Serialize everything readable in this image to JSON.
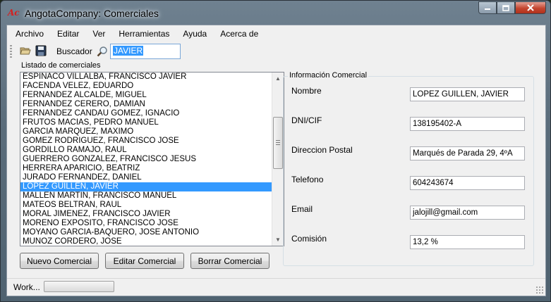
{
  "window": {
    "title": "AngotaCompany: Comerciales",
    "app_icon_text": "Ac"
  },
  "menu": [
    "Archivo",
    "Editar",
    "Ver",
    "Herramientas",
    "Ayuda",
    "Acerca de"
  ],
  "toolbar": {
    "search_label": "Buscador",
    "search_value": "JAVIER"
  },
  "list": {
    "caption": "Listado de comerciales",
    "items": [
      "ESPINACO VILLALBA, FRANCISCO JAVIER",
      "FACENDA VELEZ, EDUARDO",
      "FERNANDEZ ALCALDE, MIGUEL",
      "FERNANDEZ CERERO, DAMIAN",
      "FERNANDEZ CANDAU GOMEZ, IGNACIO",
      "FRUTOS MACIAS, PEDRO MANUEL",
      "GARCIA MARQUEZ, MAXIMO",
      "GOMEZ RODRIGUEZ, FRANCISCO JOSE",
      "GORDILLO RAMAJO, RAUL",
      "GUERRERO GONZALEZ, FRANCISCO JESUS",
      "HERRERA APARICIO, BEATRIZ",
      "JURADO FERNANDEZ, DANIEL",
      "LOPEZ GUILLEN, JAVIER",
      "MALLEN MARTIN, FRANCISCO MANUEL",
      "MATEOS BELTRAN, RAUL",
      "MORAL JIMENEZ, FRANCISCO JAVIER",
      "MORENO EXPOSITO, FRANCISCO JOSE",
      "MOYANO GARCIA-BAQUERO, JOSE ANTONIO",
      "MUÑOZ CORDERO, JOSE"
    ],
    "selected_index": 12
  },
  "buttons": {
    "new": "Nuevo Comercial",
    "edit": "Editar Comercial",
    "delete": "Borrar Comercial"
  },
  "info": {
    "legend": "Información  Comercial",
    "fields": [
      {
        "label": "Nombre",
        "value": "LOPEZ GUILLEN, JAVIER"
      },
      {
        "label": "DNI/CIF",
        "value": "138195402-A"
      },
      {
        "label": "Direccion Postal",
        "value": "Marqués de Parada 29, 4ºA"
      },
      {
        "label": "Telefono",
        "value": "604243674"
      },
      {
        "label": "Email",
        "value": "jalojill@gmail.com"
      },
      {
        "label": "Comisión",
        "value": "13,2 %"
      }
    ]
  },
  "status": {
    "text": "Work...",
    "progress": 0
  },
  "colors": {
    "selection": "#3399ff",
    "title_close": "#c4452f"
  }
}
